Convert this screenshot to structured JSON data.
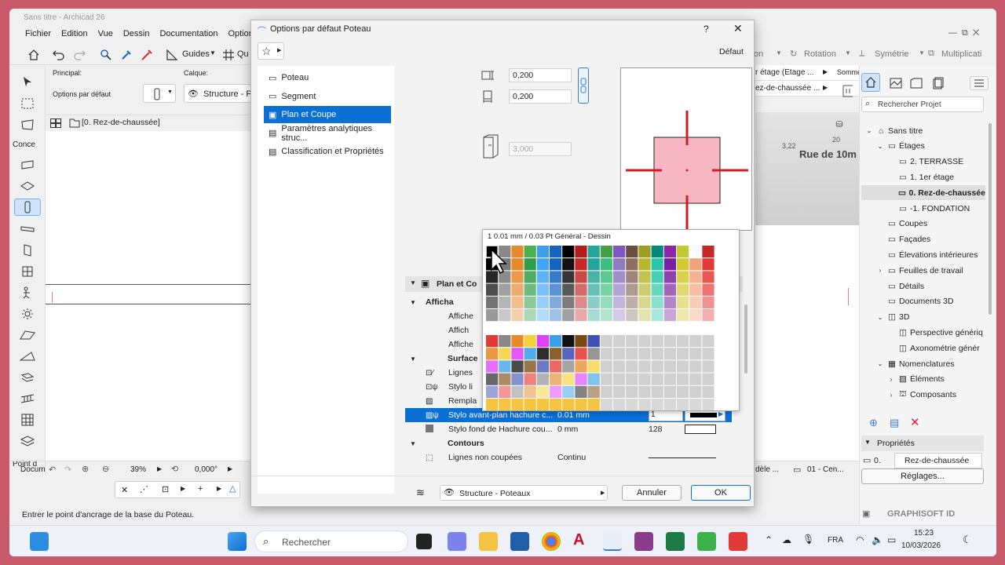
{
  "window": {
    "title": "Sans titre - Archicad 26"
  },
  "menu": [
    "Fichier",
    "Edition",
    "Vue",
    "Dessin",
    "Documentation",
    "Options"
  ],
  "toolbar": {
    "guides": "Guides",
    "qu": "Qu",
    "rotation": "Rotation",
    "symetrie": "Symétrie",
    "multiplication": "Multiplicati"
  },
  "infobox": {
    "principal": "Principal:",
    "calque": "Calque:",
    "defaut_label": "Options par défaut",
    "structure": "Structure - Po",
    "somme": "Somme"
  },
  "toolbox": {
    "concept": "Conce",
    "point": "Point d",
    "docu": "Docum"
  },
  "viewtab": {
    "label": "[0. Rez-de-chaussée]"
  },
  "statusbar": {
    "zoom": "39%",
    "angle": "0,000°",
    "view": "dèle ...",
    "layer_combo": "01 - Cen...",
    "message": "Entrer le point d'ancrage de la base du Poteau.",
    "graphisoft": "GRAPHISOFT ID"
  },
  "right_tabs": {
    "etage": "r étage (Étage ...",
    "rez": "ez-de-chaussée ..."
  },
  "plan_text": {
    "rue": "Rue de 10m",
    "n1": "3,22",
    "n2": "20"
  },
  "dialog": {
    "title": "Options par défaut Poteau",
    "help": "?",
    "close": "✕",
    "defaut": "Défaut",
    "nav": [
      "Poteau",
      "Segment",
      "Plan et Coupe",
      "Paramètres analytiques struc...",
      "Classification et Propriétés"
    ],
    "selected_nav": 2,
    "dim1": "0,200",
    "dim2": "0,200",
    "dim3": "3,000",
    "section_header": "Plan et Co",
    "sub_affichage": "Afficha",
    "rows_affiche": [
      "Affiche",
      "Affich",
      "Affiche"
    ],
    "surface": "Surface",
    "surface_rows": [
      "Lignes",
      "Stylo li",
      "Rempla"
    ],
    "selected_row": {
      "name": "Stylo avant-plan hachure c...",
      "value": "0.01 mm",
      "num": "1"
    },
    "row2": {
      "name": "Stylo fond de Hachure cou...",
      "value": "0 mm",
      "num": "128"
    },
    "contours": "Contours",
    "row3": {
      "name": "Lignes non coupées",
      "value": "Continu"
    },
    "footer_layer": "Structure - Poteaux",
    "annuler": "Annuler",
    "ok": "OK"
  },
  "palette": {
    "header": "1  0.01 mm / 0.03 Pt Général - Dessin"
  },
  "navigator": {
    "search_placeholder": "Rechercher Projet",
    "items": [
      {
        "label": "Sans titre",
        "indent": 0,
        "arrow": "v",
        "icon": "house"
      },
      {
        "label": "Étages",
        "indent": 1,
        "arrow": "v",
        "icon": "folder"
      },
      {
        "label": "2. TERRASSE",
        "indent": 2,
        "arrow": "",
        "icon": "story"
      },
      {
        "label": "1. 1er étage",
        "indent": 2,
        "arrow": "",
        "icon": "story"
      },
      {
        "label": "0. Rez-de-chaussée",
        "indent": 2,
        "arrow": "",
        "icon": "story",
        "selected": true
      },
      {
        "label": "-1. FONDATION",
        "indent": 2,
        "arrow": "",
        "icon": "story"
      },
      {
        "label": "Coupes",
        "indent": 1,
        "arrow": "",
        "icon": "folder"
      },
      {
        "label": "Façades",
        "indent": 1,
        "arrow": "",
        "icon": "folder"
      },
      {
        "label": "Élevations intérieures",
        "indent": 1,
        "arrow": "",
        "icon": "folder"
      },
      {
        "label": "Feuilles de travail",
        "indent": 1,
        "arrow": ">",
        "icon": "folder"
      },
      {
        "label": "Détails",
        "indent": 1,
        "arrow": "",
        "icon": "folder"
      },
      {
        "label": "Documents 3D",
        "indent": 1,
        "arrow": "",
        "icon": "folder"
      },
      {
        "label": "3D",
        "indent": 1,
        "arrow": "v",
        "icon": "cube"
      },
      {
        "label": "Perspective génériq",
        "indent": 2,
        "arrow": "",
        "icon": "cube"
      },
      {
        "label": "Axonométrie génér",
        "indent": 2,
        "arrow": "",
        "icon": "cube"
      },
      {
        "label": "Nomenclatures",
        "indent": 1,
        "arrow": "v",
        "icon": "grid"
      },
      {
        "label": "Éléments",
        "indent": 2,
        "arrow": ">",
        "icon": "hatch"
      },
      {
        "label": "Composants",
        "indent": 2,
        "arrow": ">",
        "icon": "comp"
      }
    ],
    "proprietes": "Propriétés",
    "prop_id": "0.",
    "prop_name": "Rez-de-chaussée",
    "reglages": "Réglages..."
  },
  "taskbar": {
    "search": "Rechercher",
    "lang": "FRA",
    "time": "15:23",
    "date": "10/03/2026"
  }
}
